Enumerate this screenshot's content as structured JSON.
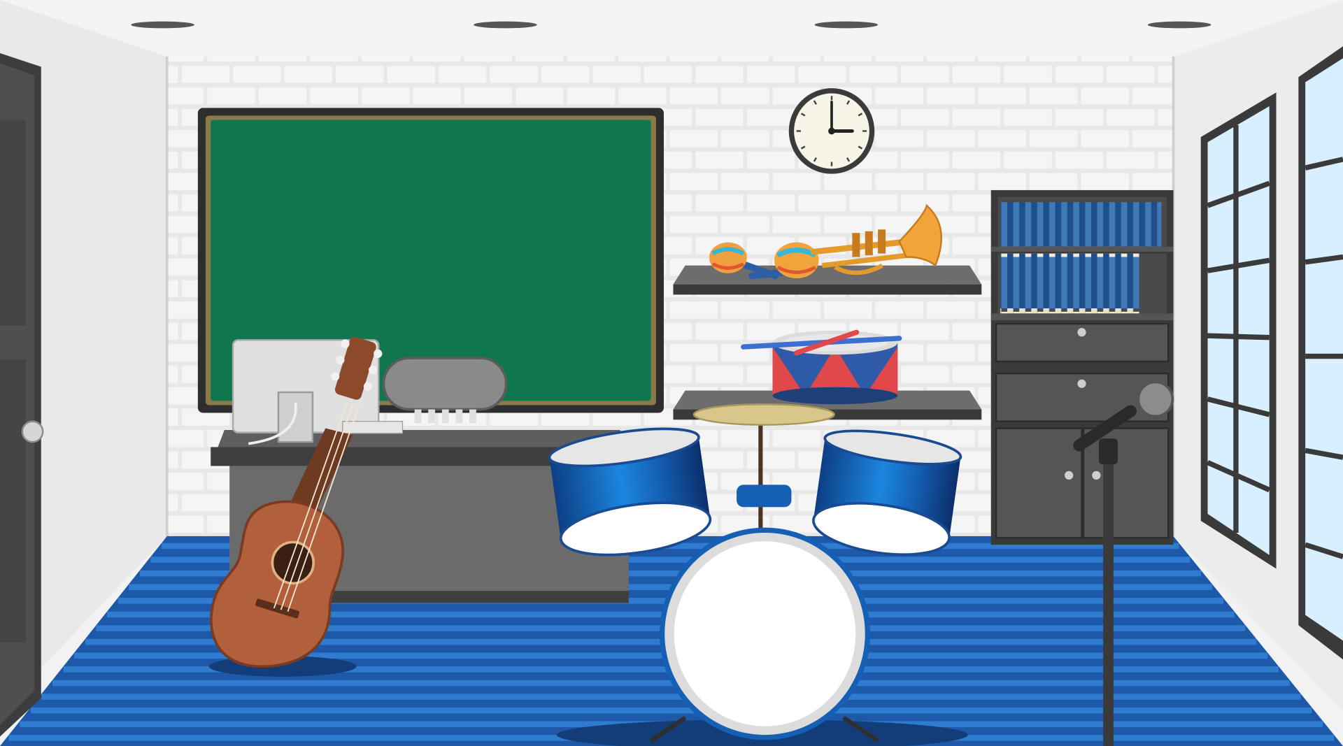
{
  "scene": {
    "title": "",
    "objects": [
      "door",
      "chalkboard",
      "wall-clock",
      "shelf",
      "maracas",
      "trumpet",
      "snare-drum",
      "bookshelf",
      "teacher-desk",
      "computer-monitor",
      "office-chair",
      "acoustic-guitar",
      "drum-kit",
      "microphone-stand",
      "window"
    ]
  },
  "clock": {
    "hour": 3,
    "minute": 0
  },
  "colors": {
    "wall": "#eeeeee",
    "brick_wall": "#e6e6e6",
    "ceiling": "#f4f4f4",
    "chalkboard": "#0f764e",
    "floor_dark": "#1d59a8",
    "floor_light": "#2f7bd0",
    "drum_blue": "#1560b5",
    "furniture_gray": "#5a5a5a",
    "guitar_wood": "#b25f3c",
    "window_glass": "#d7efff"
  }
}
